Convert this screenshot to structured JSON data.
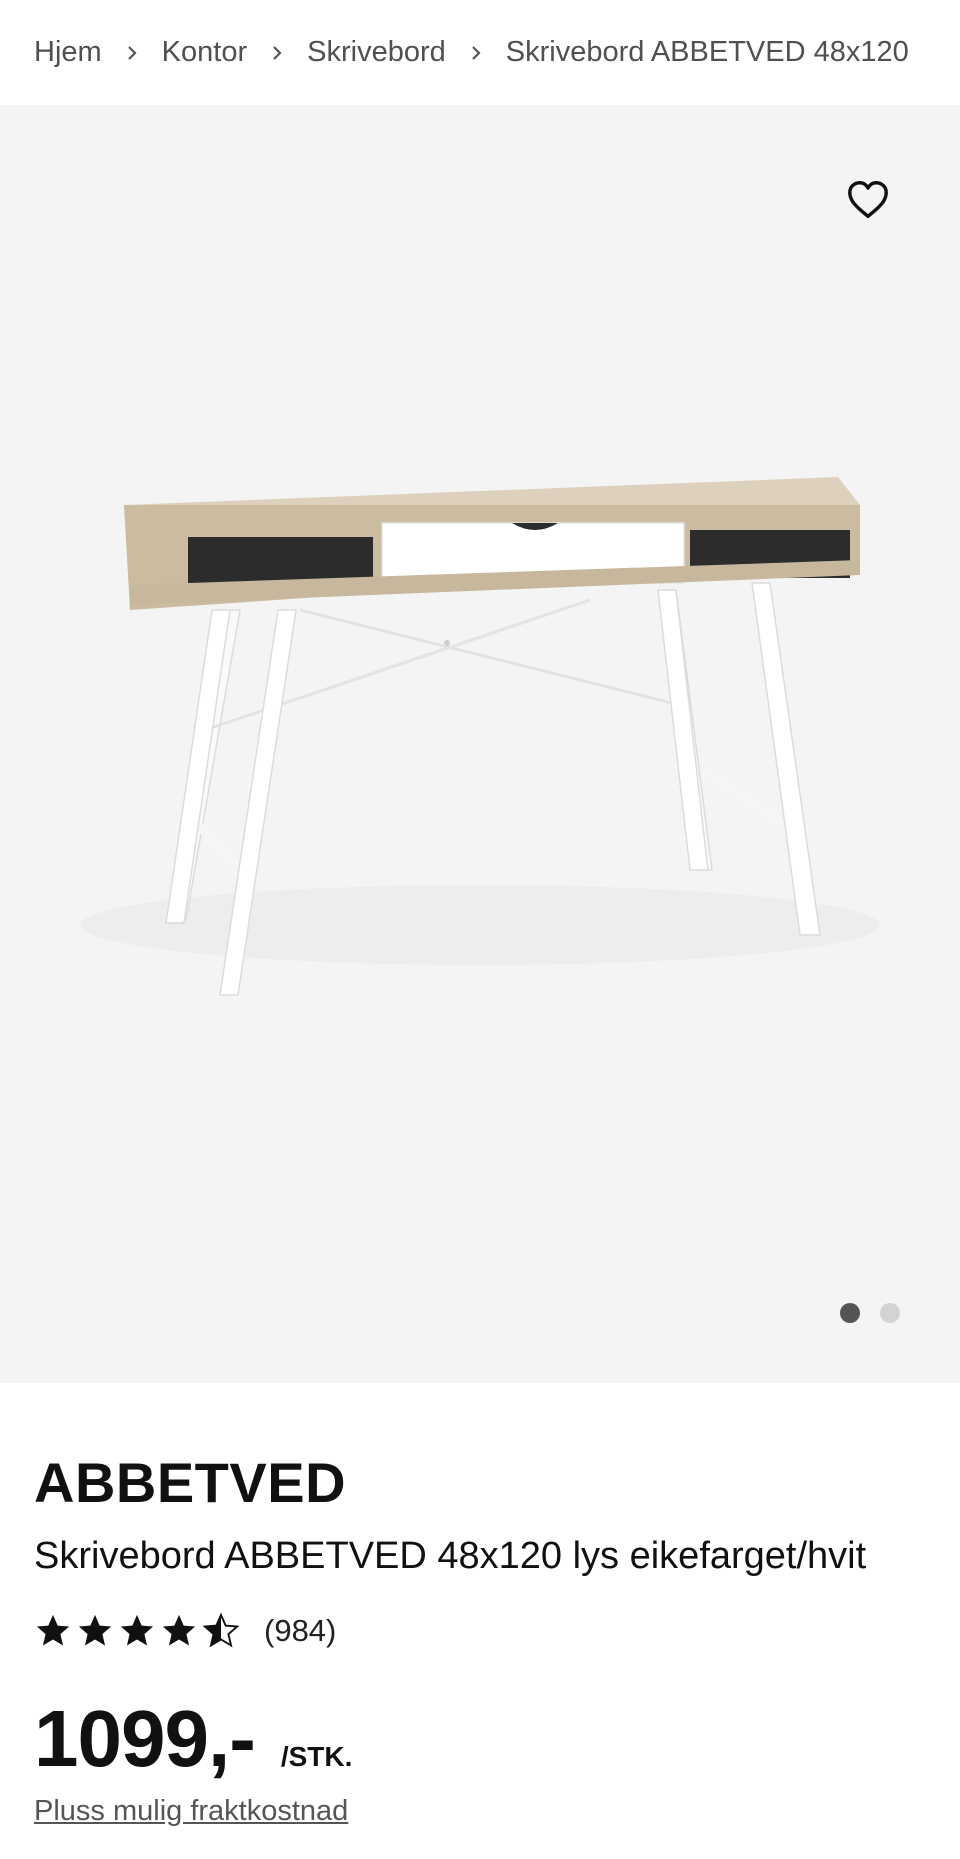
{
  "breadcrumb": {
    "items": [
      {
        "label": "Hjem"
      },
      {
        "label": "Kontor"
      },
      {
        "label": "Skrivebord"
      },
      {
        "label": "Skrivebord ABBETVED 48x120"
      }
    ]
  },
  "gallery": {
    "favorite_icon": "heart-outline-icon",
    "image_count": 2,
    "active_index": 0
  },
  "product": {
    "brand": "ABBETVED",
    "name": "Skrivebord ABBETVED 48x120 lys eikefarget/hvit",
    "rating": {
      "value": 4.5,
      "max": 5,
      "count_label": "(984)"
    },
    "price": "1099,-",
    "unit": "/STK.",
    "shipping_note": "Pluss mulig fraktkostnad"
  },
  "colors": {
    "gallery_bg": "#f4f4f4",
    "text": "#111111",
    "muted": "#555555",
    "dot_active": "#555555",
    "dot_inactive": "#d3d3d3"
  }
}
